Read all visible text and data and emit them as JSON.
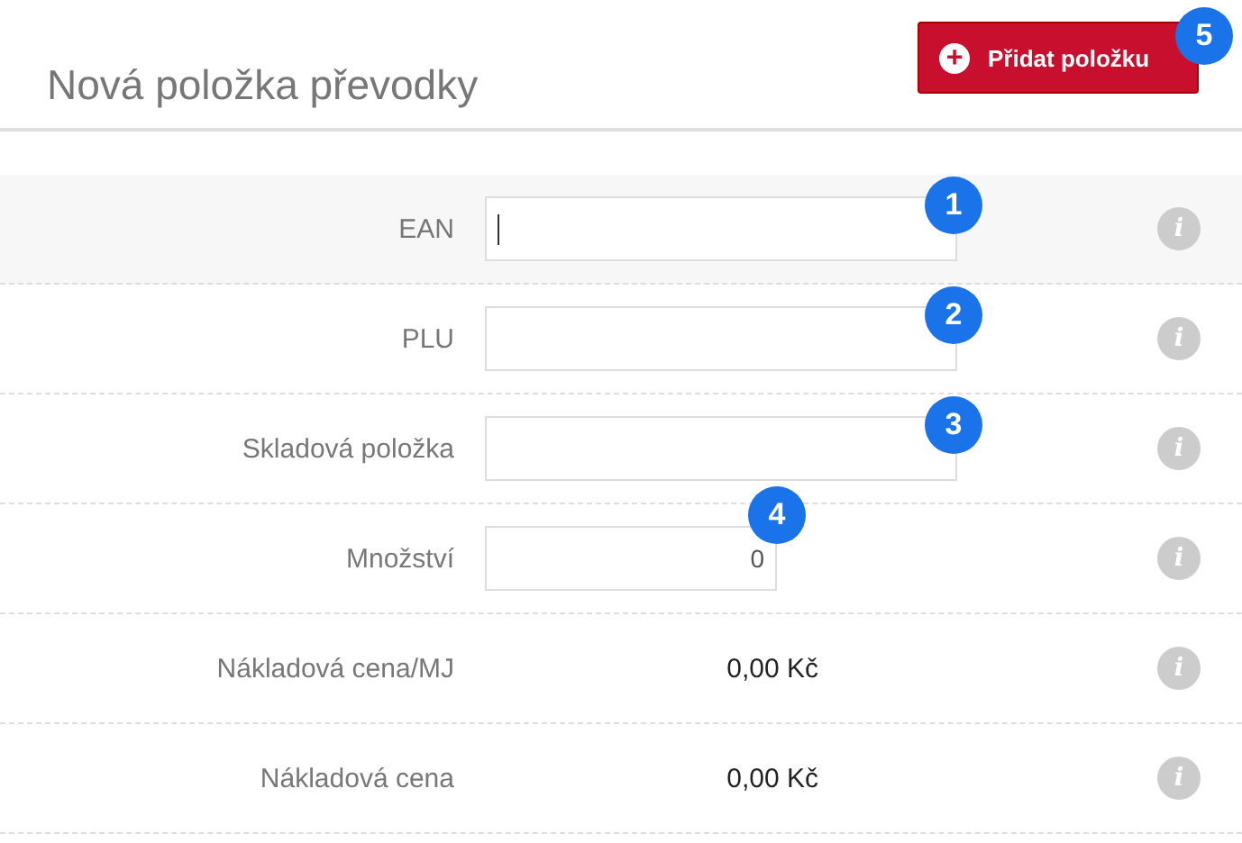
{
  "title": "Nová položka převodky",
  "add_button": {
    "icon": "+",
    "label": "Přidat položku",
    "badge": "5"
  },
  "rows": [
    {
      "kind": "input",
      "label": "EAN",
      "value": "",
      "focused": true,
      "badge": "1",
      "info": "i"
    },
    {
      "kind": "input",
      "label": "PLU",
      "value": "",
      "focused": false,
      "badge": "2",
      "info": "i"
    },
    {
      "kind": "input",
      "label": "Skladová položka",
      "value": "",
      "focused": false,
      "badge": "3",
      "info": "i"
    },
    {
      "kind": "number",
      "label": "Množství",
      "value": "0",
      "focused": false,
      "badge": "4",
      "info": "i"
    },
    {
      "kind": "value",
      "label": "Nákladová cena/MJ",
      "value": "0,00 Kč",
      "info": "i"
    },
    {
      "kind": "value",
      "label": "Nákladová cena",
      "value": "0,00 Kč",
      "info": "i"
    }
  ]
}
